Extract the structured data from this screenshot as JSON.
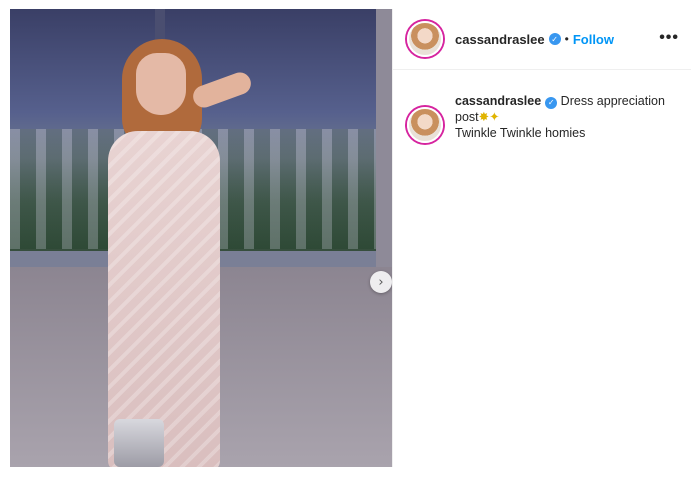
{
  "post": {
    "username": "cassandraslee",
    "follow_label": "Follow",
    "separator": "•",
    "more_icon": "•••",
    "next_icon": "›"
  },
  "caption": {
    "username": "cassandraslee",
    "text_line1": "Dress appreciation",
    "text_line2": "post",
    "emojis": "✸✦",
    "text_line3": "Twinkle Twinkle homies"
  },
  "icons": {
    "verified": "✓"
  },
  "colors": {
    "accent": "#0095f6",
    "verified": "#3897f0",
    "story_ring": "#d6249f"
  }
}
